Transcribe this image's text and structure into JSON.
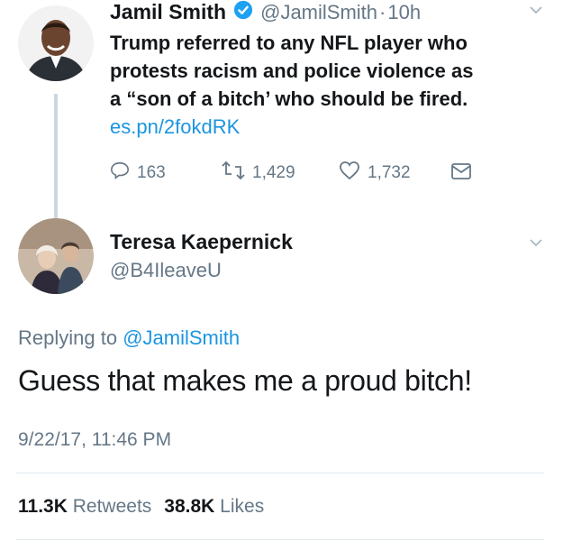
{
  "tweet": {
    "author_name": "Jamil Smith",
    "handle": "@JamilSmith",
    "separator": "·",
    "time": "10h",
    "text_lines": [
      "Trump referred to any NFL player who",
      "protests racism and police violence as",
      "a “son of a bitch’ who should be fired."
    ],
    "link": "es.pn/2fokdRK",
    "replies": "163",
    "retweets": "1,429",
    "likes": "1,732",
    "icons": [
      "verified-badge-icon",
      "reply-icon",
      "retweet-icon",
      "like-icon",
      "message-icon",
      "caret-down-icon"
    ]
  },
  "reply": {
    "author_name": "Teresa Kaepernick",
    "handle": "@B4IleaveU",
    "replying_label": "Replying to",
    "replying_mention": "@JamilSmith",
    "text": "Guess that makes me a proud bitch!",
    "timestamp": "9/22/17, 11:46 PM",
    "retweet_count": "11.3K",
    "retweet_label": "Retweets",
    "like_count": "38.8K",
    "like_label": "Likes"
  },
  "colors": {
    "link_blue": "#1b95e0",
    "secondary_gray": "#657786",
    "thread_line": "#cbd8e2",
    "divider": "#e1e8ed",
    "verified_blue": "#1da1f2"
  }
}
